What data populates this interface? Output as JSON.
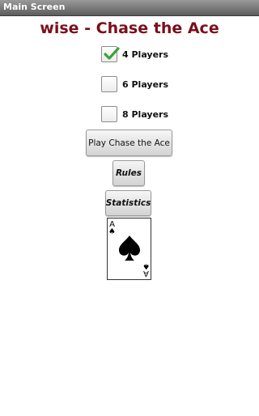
{
  "window": {
    "title": "Main Screen"
  },
  "app_title": "wise - Chase the Ace",
  "options": [
    {
      "label": "4 Players",
      "checked": true
    },
    {
      "label": "6 Players",
      "checked": false
    },
    {
      "label": "8 Players",
      "checked": false
    }
  ],
  "buttons": {
    "play": "Play Chase the Ace",
    "rules": "Rules",
    "statistics": "Statistics"
  },
  "card": {
    "rank": "A",
    "suit": "spade-icon"
  },
  "colors": {
    "title": "#7a0f1c",
    "check": "#3aa33a",
    "titlebar": "#6e6e6e"
  }
}
